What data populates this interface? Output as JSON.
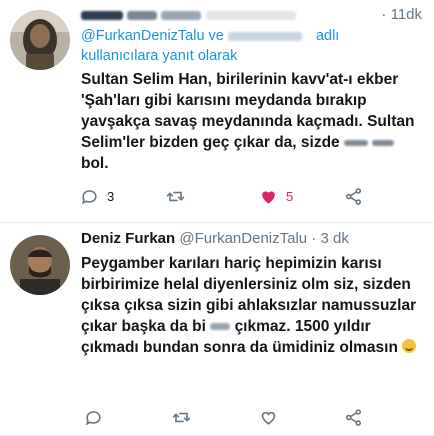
{
  "tweet1": {
    "time": "· 11dk",
    "reply_prefix": "@FurkanDenizTalu ve",
    "reply_suffix": "adlı",
    "reply_line2": "kullanıcılara yanıt olarak",
    "text_lines": [
      "Sultan Selim Han, birilerinin kavv'at-ı ekber",
      "'Şah'ları gibi karısını meydanda bırakıp",
      "yavşakça savaş meydanında kaçmadı. Sultan",
      "Selim'ler bizden geç çıkar da, sizde",
      "bol."
    ],
    "reply_count": "3",
    "like_count": "5",
    "colors": {
      "like": "#e0245e",
      "icon": "#657786"
    }
  },
  "tweet2": {
    "name": "Deniz Furkan",
    "handle": "@FurkanDenizTalu · 3 dk",
    "text_lines": [
      "Peygamber karıları hariç hepimizin karısı",
      "birbirimize helal diyenlersiniz olm siz, sizden",
      "çıksa çıksa sizin gibi ahlaksızlar namussuzlar",
      "çıkar başka da bi",
      "çıkmaz. 1500 yıldır",
      "çıkmadı bundan sonra da ümidiniz olmasın"
    ],
    "icons": [
      "reply-icon",
      "retweet-icon",
      "like-icon",
      "share-icon"
    ]
  }
}
